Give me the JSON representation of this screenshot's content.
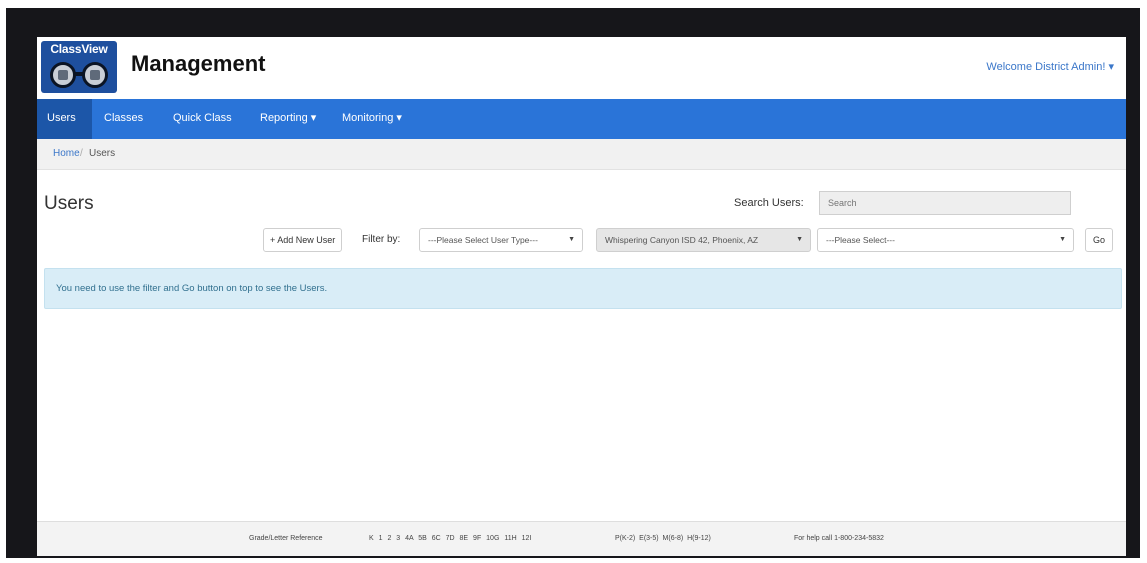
{
  "header": {
    "logo_text": "ClassView",
    "app_title": "Management",
    "welcome": "Welcome District Admin! ▾"
  },
  "nav": {
    "items": [
      {
        "label": "Users",
        "active": true
      },
      {
        "label": "Classes"
      },
      {
        "label": "Quick Class"
      },
      {
        "label": "Reporting ▾"
      },
      {
        "label": "Monitoring ▾"
      }
    ]
  },
  "breadcrumb": {
    "home": "Home",
    "separator": "/",
    "current": "Users"
  },
  "users_page": {
    "title": "Users",
    "search_label": "Search Users:",
    "search_placeholder": "Search",
    "add_button": "+ Add New User",
    "filter_label": "Filter by:",
    "user_type_select": "---Please Select User Type---",
    "district_select": "Whispering Canyon ISD 42, Phoenix, AZ",
    "secondary_select": "---Please Select---",
    "go_button": "Go",
    "info_message": "You need to use the filter and Go button on top to see the Users."
  },
  "footer": {
    "reference_label": "Grade/Letter Reference",
    "grades": "K 1 2 3 4A 5B 6C 7D 8E 9F 10G 11H 12I",
    "ranges": "P(K-2) E(3-5) M(6-8) H(9-12)",
    "help": "For help call 1-800-234-5832"
  },
  "colors": {
    "navbar": "#2a74d8",
    "nav_active": "#1c56a8",
    "link": "#3b77c9",
    "info_bg": "#d9edf7",
    "info_text": "#31708f"
  },
  "icons": {
    "caret": "caret-down-icon",
    "logo": "classview-logo-icon"
  }
}
